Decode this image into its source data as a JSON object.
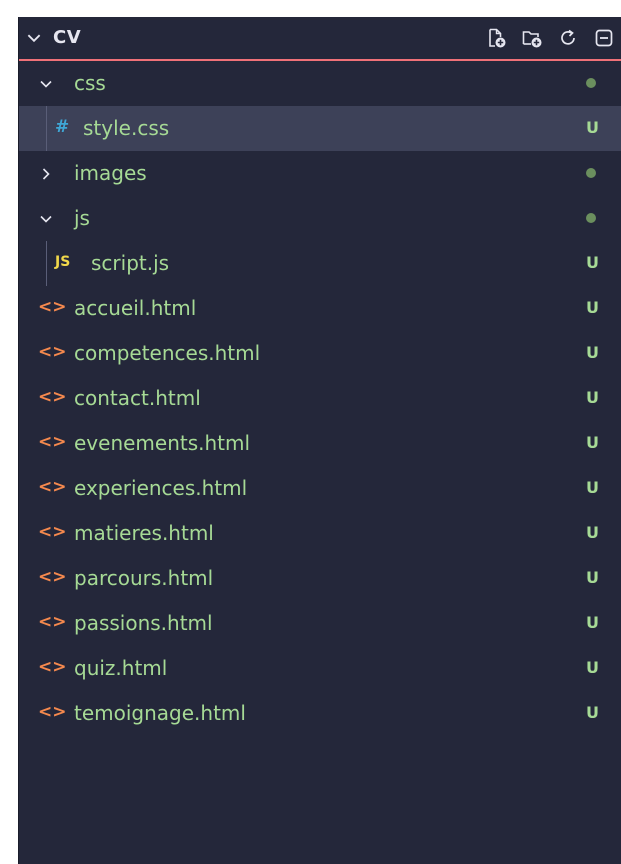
{
  "explorer": {
    "title": "CV",
    "actions": [
      {
        "name": "new-file-button",
        "icon": "new-file-icon"
      },
      {
        "name": "new-folder-button",
        "icon": "new-folder-icon"
      },
      {
        "name": "refresh-button",
        "icon": "refresh-icon"
      },
      {
        "name": "collapse-all-button",
        "icon": "collapse-all-icon"
      }
    ]
  },
  "colors": {
    "panel_bg": "#24273a",
    "selected_bg": "#3d4158",
    "untracked_green": "#a6da95",
    "html_icon": "#f5894e",
    "css_icon": "#3fa7d6",
    "js_icon": "#f1d84b",
    "header_border": "#f07178"
  },
  "tree": [
    {
      "label": "css",
      "kind": "folder",
      "expanded": true,
      "depth": 0,
      "status": "dot"
    },
    {
      "label": "style.css",
      "kind": "css",
      "depth": 1,
      "status": "U",
      "icon_text": "#",
      "selected": true
    },
    {
      "label": "images",
      "kind": "folder",
      "expanded": false,
      "depth": 0,
      "status": "dot"
    },
    {
      "label": "js",
      "kind": "folder",
      "expanded": true,
      "depth": 0,
      "status": "dot"
    },
    {
      "label": "script.js",
      "kind": "js",
      "depth": 1,
      "status": "U",
      "icon_text": "JS"
    },
    {
      "label": "accueil.html",
      "kind": "html",
      "depth": 0,
      "status": "U",
      "icon_text": "<>"
    },
    {
      "label": "competences.html",
      "kind": "html",
      "depth": 0,
      "status": "U",
      "icon_text": "<>"
    },
    {
      "label": "contact.html",
      "kind": "html",
      "depth": 0,
      "status": "U",
      "icon_text": "<>"
    },
    {
      "label": "evenements.html",
      "kind": "html",
      "depth": 0,
      "status": "U",
      "icon_text": "<>"
    },
    {
      "label": "experiences.html",
      "kind": "html",
      "depth": 0,
      "status": "U",
      "icon_text": "<>"
    },
    {
      "label": "matieres.html",
      "kind": "html",
      "depth": 0,
      "status": "U",
      "icon_text": "<>"
    },
    {
      "label": "parcours.html",
      "kind": "html",
      "depth": 0,
      "status": "U",
      "icon_text": "<>"
    },
    {
      "label": "passions.html",
      "kind": "html",
      "depth": 0,
      "status": "U",
      "icon_text": "<>"
    },
    {
      "label": "quiz.html",
      "kind": "html",
      "depth": 0,
      "status": "U",
      "icon_text": "<>"
    },
    {
      "label": "temoignage.html",
      "kind": "html",
      "depth": 0,
      "status": "U",
      "icon_text": "<>"
    }
  ]
}
